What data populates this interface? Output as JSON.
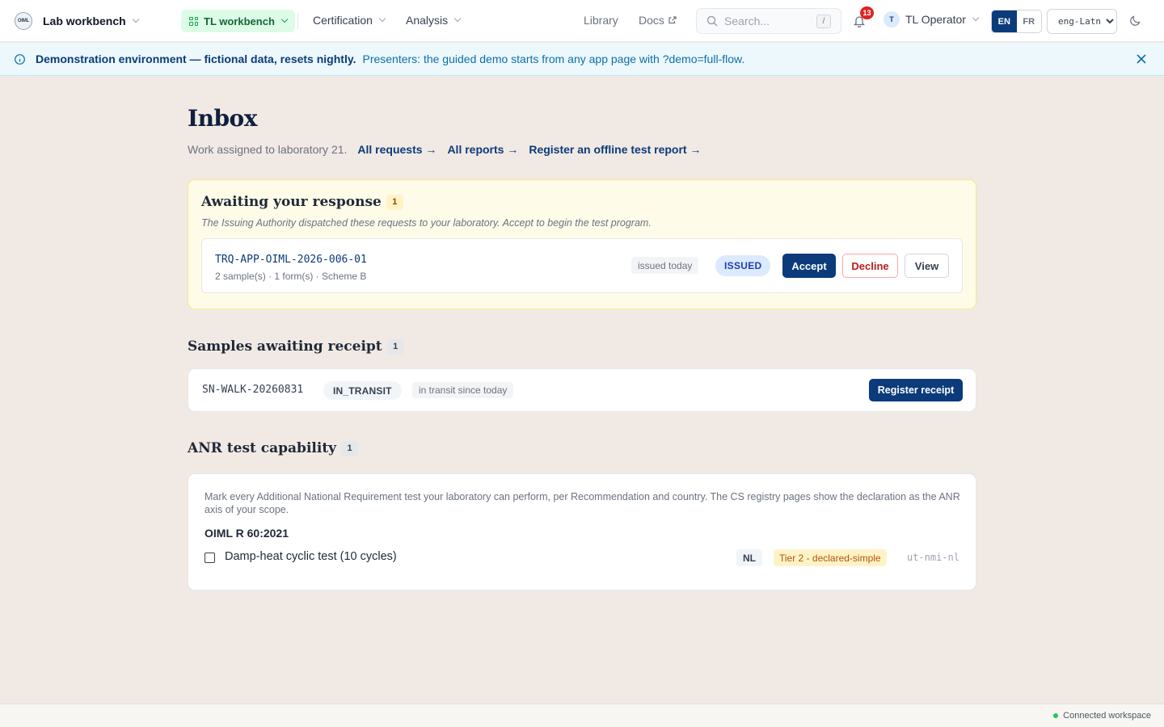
{
  "header": {
    "brand_logo_text": "OIML",
    "app_name": "Lab workbench",
    "workspace_label": "TL workbench",
    "menu": [
      {
        "label": "Certification"
      },
      {
        "label": "Analysis"
      }
    ],
    "library_label": "Library",
    "docs_label": "Docs",
    "search": {
      "placeholder": "Search...",
      "shortcut": "/"
    },
    "notifications_count": "13",
    "user": {
      "initial": "T",
      "name": "TL Operator"
    },
    "lang": {
      "en": "EN",
      "fr": "FR"
    },
    "script_select": {
      "value": "eng-Latn"
    }
  },
  "banner": {
    "strong": "Demonstration environment — fictional data, resets nightly.",
    "text": "Presenters: the guided demo starts from any app page with ?demo=full-flow."
  },
  "page": {
    "title": "Inbox",
    "subtitle": "Work assigned to laboratory 21.",
    "links": [
      {
        "label": "All requests →"
      },
      {
        "label": "All reports →"
      },
      {
        "label": "Register an offline test report →"
      }
    ]
  },
  "awaiting": {
    "title": "Awaiting your response",
    "count": "1",
    "description": "The Issuing Authority dispatched these requests to your laboratory. Accept to begin the test program.",
    "request": {
      "id": "TRQ-APP-OIML-2026-006-01",
      "meta": "2 sample(s) · 1 form(s) · Scheme B",
      "issued": "issued today",
      "status": "ISSUED",
      "accept_label": "Accept",
      "decline_label": "Decline",
      "view_label": "View"
    }
  },
  "samples": {
    "title": "Samples awaiting receipt",
    "count": "1",
    "item": {
      "id": "SN-WALK-20260831",
      "status": "IN_TRANSIT",
      "since": "in transit since today",
      "action_label": "Register receipt"
    }
  },
  "anr": {
    "title": "ANR test capability",
    "count": "1",
    "description": "Mark every Additional National Requirement test your laboratory can perform, per Recommendation and country. The CS registry pages show the declaration as the ANR axis of your scope.",
    "recommendation": "OIML R 60:2021",
    "test": {
      "label": "Damp-heat cyclic test (10 cycles)",
      "country": "NL",
      "tier": "Tier 2 - declared-simple",
      "code": "ut-nmi-nl"
    }
  },
  "footer": {
    "status": "Connected workspace"
  },
  "colors": {
    "primary": "#0b3b7a",
    "page_bg": "#f1e9e4",
    "banner_bg": "#ecf8fc",
    "await_bg": "#fefce8",
    "danger": "#b91c1c",
    "notification": "#dc2626"
  }
}
